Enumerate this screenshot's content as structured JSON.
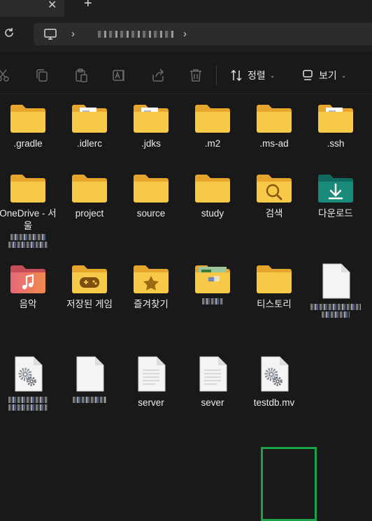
{
  "tabbar": {
    "close_glyph": "✕",
    "new_tab_glyph": "+"
  },
  "addressbar": {
    "refresh_icon": "refresh-icon",
    "location_icon": "monitor-icon",
    "chevron": "›"
  },
  "toolbar": {
    "sort_label": "정렬",
    "view_label": "보기",
    "caret": "⌄"
  },
  "items": [
    {
      "label": ".gradle",
      "icon": "folder"
    },
    {
      "label": ".idlerc",
      "icon": "folder-docs"
    },
    {
      "label": ".jdks",
      "icon": "folder-docs"
    },
    {
      "label": ".m2",
      "icon": "folder"
    },
    {
      "label": ".ms-ad",
      "icon": "folder"
    },
    {
      "label": ".ssh",
      "icon": "folder-docs"
    },
    {
      "label": "OneDrive - 서울",
      "icon": "folder"
    },
    {
      "label": "project",
      "icon": "folder"
    },
    {
      "label": "source",
      "icon": "folder"
    },
    {
      "label": "study",
      "icon": "folder"
    },
    {
      "label": "검색",
      "icon": "folder-search"
    },
    {
      "label": "다운로드",
      "icon": "folder-download"
    },
    {
      "label": "음악",
      "icon": "folder-music"
    },
    {
      "label": "저장된 게임",
      "icon": "folder-game"
    },
    {
      "label": "즐겨찾기",
      "icon": "folder-star"
    },
    {
      "label": "",
      "icon": "folder-image"
    },
    {
      "label": "티스토리",
      "icon": "folder"
    },
    {
      "label": "",
      "icon": "file-blank"
    },
    {
      "label": "",
      "icon": "file-gear"
    },
    {
      "label": "",
      "icon": "file-blank"
    },
    {
      "label": "server",
      "icon": "file-lines"
    },
    {
      "label": "sever",
      "icon": "file-lines"
    },
    {
      "label": "testdb.mv",
      "icon": "file-gear"
    }
  ],
  "colors": {
    "background": "#191919",
    "folder": "#f7c948",
    "folder_back": "#e6a52c",
    "selection": "#1aa34a",
    "download": "#1a8a7a"
  }
}
